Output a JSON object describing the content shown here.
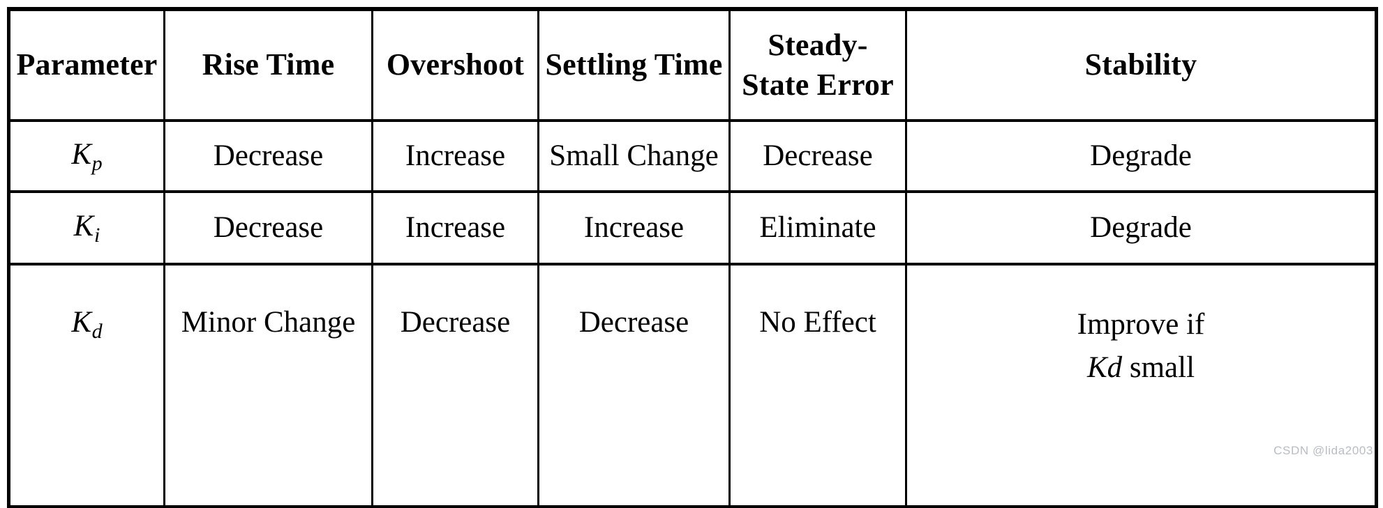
{
  "document": {
    "type": "table",
    "watermark": "CSDN @lida2003"
  },
  "table": {
    "columns": [
      {
        "key": "parameter",
        "header": "Parameter"
      },
      {
        "key": "rise_time",
        "header": "Rise Time"
      },
      {
        "key": "overshoot",
        "header": "Overshoot"
      },
      {
        "key": "settling",
        "header": "Settling Time"
      },
      {
        "key": "sse",
        "header": "Steady-State Error"
      },
      {
        "key": "stability",
        "header": "Stability"
      }
    ],
    "rows": [
      {
        "parameter_symbol": "K",
        "parameter_subscript": "p",
        "rise_time": "Decrease",
        "overshoot": "Increase",
        "settling": "Small Change",
        "sse": "Decrease",
        "stability": "Degrade"
      },
      {
        "parameter_symbol": "K",
        "parameter_subscript": "i",
        "rise_time": "Decrease",
        "overshoot": "Increase",
        "settling": "Increase",
        "sse": "Eliminate",
        "stability": "Degrade"
      },
      {
        "parameter_symbol": "K",
        "parameter_subscript": "d",
        "rise_time": "Minor Change",
        "overshoot": "Decrease",
        "settling": "Decrease",
        "sse": "No Effect",
        "stability_line1": "Improve if",
        "stability_line2_symbol": "K",
        "stability_line2_subscript": "d",
        "stability_line2_tail": " small"
      }
    ]
  },
  "colors": {
    "border": "#000000",
    "text": "#000000",
    "background": "#ffffff",
    "watermark": "#b9bcc2"
  }
}
